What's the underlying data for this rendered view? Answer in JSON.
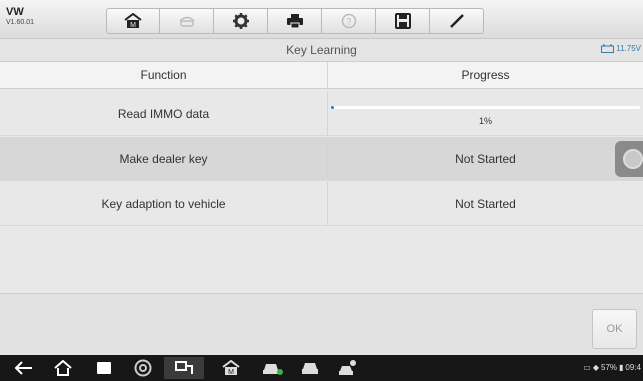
{
  "app": {
    "name": "VW",
    "version": "V1.60.01"
  },
  "toolbar": {
    "buttons": [
      {
        "icon": "home-icon"
      },
      {
        "icon": "vehicle-swap-icon"
      },
      {
        "icon": "gear-icon"
      },
      {
        "icon": "printer-icon"
      },
      {
        "icon": "help-icon"
      },
      {
        "icon": "save-icon"
      },
      {
        "icon": "pen-icon"
      }
    ]
  },
  "title": "Key Learning",
  "voltage": "11.75V",
  "table": {
    "headers": [
      "Function",
      "Progress"
    ],
    "rows": [
      {
        "function": "Read IMMO data",
        "progress": 0.01,
        "progress_text": "1%"
      },
      {
        "function": "Make dealer key",
        "status": "Not Started"
      },
      {
        "function": "Key adaption to vehicle",
        "status": "Not Started"
      }
    ]
  },
  "footer": {
    "ok_label": "OK"
  },
  "android_nav": {
    "icons": [
      "back-icon",
      "home-icon",
      "recents-icon",
      "chrome-icon",
      "remote-icon",
      "vehicle-home-icon",
      "car-diagnostic-icon",
      "car-icon",
      "car-person-icon"
    ]
  },
  "status_bar": {
    "battery": "57%",
    "time": "09:4"
  },
  "colors": {
    "accent": "#2b7bd8",
    "voltage": "#3a7aa8",
    "navbar": "#171717"
  }
}
